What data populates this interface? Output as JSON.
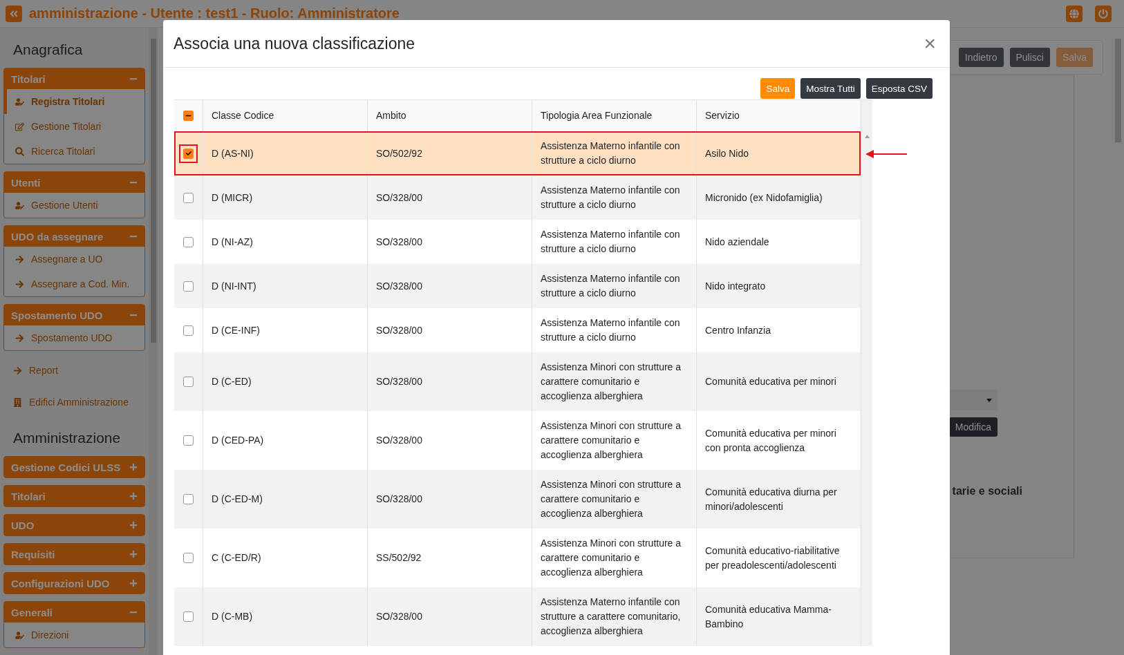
{
  "header": {
    "title": "amministrazione - Utente : test1 - Ruolo: Amministratore"
  },
  "sidebar": {
    "sections": [
      {
        "heading": "Anagrafica",
        "groups": [
          {
            "title": "Titolari",
            "expanded": true,
            "items": [
              {
                "label": "Registra Titolari",
                "kind": "user",
                "selected": true
              },
              {
                "label": "Gestione Titolari",
                "kind": "edit",
                "selected": false
              },
              {
                "label": "Ricerca Titolari",
                "kind": "search",
                "selected": false
              }
            ]
          },
          {
            "title": "Utenti",
            "expanded": true,
            "items": [
              {
                "label": "Gestione Utenti",
                "kind": "user",
                "selected": false
              }
            ]
          },
          {
            "title": "UDO da assegnare",
            "expanded": true,
            "items": [
              {
                "label": "Assegnare a UO",
                "kind": "arrow",
                "selected": false
              },
              {
                "label": "Assegnare a Cod. Min.",
                "kind": "arrow",
                "selected": false
              }
            ]
          },
          {
            "title": "Spostamento UDO",
            "expanded": true,
            "items": [
              {
                "label": "Spostamento UDO",
                "kind": "arrow",
                "selected": false
              }
            ]
          }
        ],
        "links": [
          {
            "label": "Report",
            "kind": "arrow"
          },
          {
            "label": "Edifici Amministrazione",
            "kind": "building"
          }
        ]
      },
      {
        "heading": "Amministrazione",
        "groups": [
          {
            "title": "Gestione Codici ULSS",
            "expanded": false
          },
          {
            "title": "Titolari",
            "expanded": false
          },
          {
            "title": "UDO",
            "expanded": false
          },
          {
            "title": "Requisiti",
            "expanded": false
          },
          {
            "title": "Configurazioni UDO",
            "expanded": false
          },
          {
            "title": "Generali",
            "expanded": true,
            "items": [
              {
                "label": "Direzioni",
                "kind": "user",
                "selected": false
              }
            ]
          }
        ]
      }
    ]
  },
  "background": {
    "buttons": [
      "Indietro",
      "Pulisci",
      "Salva"
    ],
    "edit_button": "Modifica",
    "text": "tarie e sociali"
  },
  "modal": {
    "title": "Associa una nuova classificazione",
    "close": "×",
    "buttons": [
      {
        "label": "Salva",
        "kind": "primary"
      },
      {
        "label": "Mostra Tutti",
        "kind": "dark"
      },
      {
        "label": "Esposta CSV",
        "kind": "dark"
      }
    ],
    "table": {
      "select_all": {
        "indeterminate": true
      },
      "columns": [
        "Classe Codice",
        "Ambito",
        "Tipologia Area Funzionale",
        "Servizio"
      ],
      "rows": [
        {
          "selected": true,
          "marked": true,
          "cells": [
            "D (AS-NI)",
            "SO/502/92",
            "Assistenza Materno infantile con strutture a ciclo diurno",
            "Asilo Nido"
          ]
        },
        {
          "selected": false,
          "marked": false,
          "cells": [
            "D (MICR)",
            "SO/328/00",
            "Assistenza Materno infantile con strutture a ciclo diurno",
            "Micronido (ex Nidofamiglia)"
          ]
        },
        {
          "selected": false,
          "marked": false,
          "cells": [
            "D (NI-AZ)",
            "SO/328/00",
            "Assistenza Materno infantile con strutture a ciclo diurno",
            "Nido aziendale"
          ]
        },
        {
          "selected": false,
          "marked": false,
          "cells": [
            "D (NI-INT)",
            "SO/328/00",
            "Assistenza Materno infantile con strutture a ciclo diurno",
            "Nido integrato"
          ]
        },
        {
          "selected": false,
          "marked": false,
          "cells": [
            "D (CE-INF)",
            "SO/328/00",
            "Assistenza Materno infantile con strutture a ciclo diurno",
            "Centro Infanzia"
          ]
        },
        {
          "selected": false,
          "marked": false,
          "cells": [
            "D (C-ED)",
            "SO/328/00",
            "Assistenza Minori con strutture a carattere comunitario e accoglienza alberghiera",
            "Comunità educativa per minori"
          ]
        },
        {
          "selected": false,
          "marked": false,
          "cells": [
            "D (CED-PA)",
            "SO/328/00",
            "Assistenza Minori con strutture a carattere comunitario e accoglienza alberghiera",
            "Comunità educativa per minori con pronta accoglienza"
          ]
        },
        {
          "selected": false,
          "marked": false,
          "cells": [
            "D (C-ED-M)",
            "SO/328/00",
            "Assistenza Minori con strutture a carattere comunitario e accoglienza alberghiera",
            "Comunità educativa diurna per minori/adolescenti"
          ]
        },
        {
          "selected": false,
          "marked": false,
          "cells": [
            "C (C-ED/R)",
            "SS/502/92",
            "Assistenza Minori con strutture a carattere comunitario e accoglienza alberghiera",
            "Comunità educativo-riabilitative per preadolescenti/adolescenti"
          ]
        },
        {
          "selected": false,
          "marked": false,
          "cells": [
            "D (C-MB)",
            "SO/328/00",
            "Assistenza Materno infantile con strutture a carattere comunitario, accoglienza alberghiera",
            "Comunità educativa Mamma-Bambino"
          ]
        }
      ]
    }
  }
}
